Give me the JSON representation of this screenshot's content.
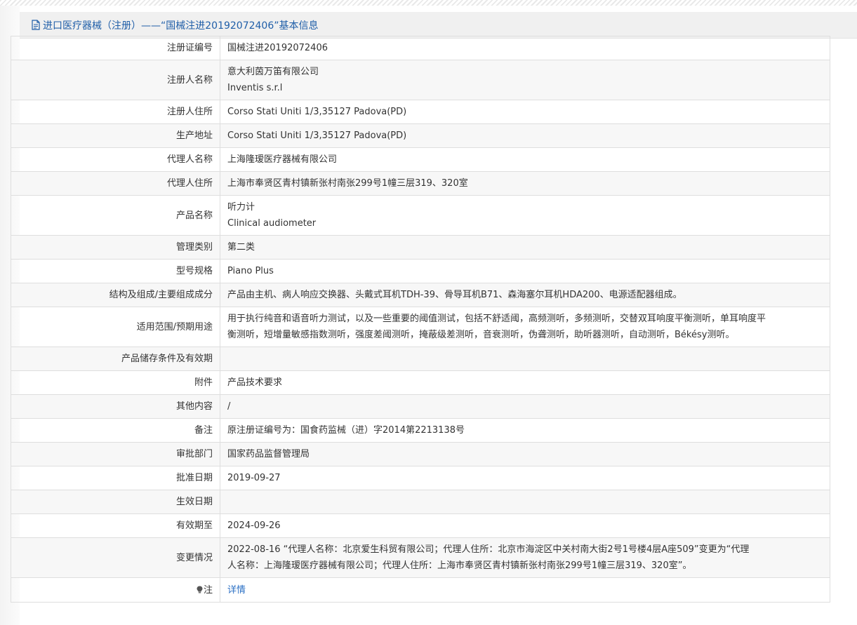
{
  "header": {
    "title": "进口医疗器械（注册）——“国械注进20192072406”基本信息"
  },
  "fields": {
    "reg_no": {
      "label": "注册证编号",
      "value": "国械注进20192072406"
    },
    "registrant": {
      "label": "注册人名称",
      "line1": "意大利茵万笛有限公司",
      "line2": "Inventis s.r.l"
    },
    "registrant_address": {
      "label": "注册人住所",
      "value": "Corso Stati Uniti 1/3,35127 Padova(PD)"
    },
    "production_address": {
      "label": "生产地址",
      "value": "Corso Stati Uniti 1/3,35127 Padova(PD)"
    },
    "agent_name": {
      "label": "代理人名称",
      "value": "上海隆瑷医疗器械有限公司"
    },
    "agent_address": {
      "label": "代理人住所",
      "value": "上海市奉贤区青村镇新张村南张299号1幢三层319、320室"
    },
    "product_name": {
      "label": "产品名称",
      "line1": "听力计",
      "line2": "Clinical audiometer"
    },
    "management_class": {
      "label": "管理类别",
      "value": "第二类"
    },
    "model": {
      "label": "型号规格",
      "value": "Piano Plus"
    },
    "structure": {
      "label": "结构及组成/主要组成成分",
      "value": "产品由主机、病人响应交换器、头戴式耳机TDH-39、骨导耳机B71、森海塞尔耳机HDA200、电源适配器组成。"
    },
    "intended_use": {
      "label": "适用范围/预期用途",
      "line1": "用于执行纯音和语音听力测试，以及一些重要的阈值测试，包括不舒适阈，高频测听，多频测听，交替双耳响度平衡测听，单耳响度平",
      "line2": "衡测听，短增量敏感指数测听，强度差阈测听，掩蔽级差测听，音衰测听，伪聋测听，助听器测听，自动测听，Békésy测听。"
    },
    "storage": {
      "label": "产品储存条件及有效期",
      "value": ""
    },
    "attachment": {
      "label": "附件",
      "value": "产品技术要求"
    },
    "other": {
      "label": "其他内容",
      "value": "/"
    },
    "remark": {
      "label": "备注",
      "value": "原注册证编号为：国食药监械（进）字2014第2213138号"
    },
    "approval_dept": {
      "label": "审批部门",
      "value": "国家药品监督管理局"
    },
    "approval_date": {
      "label": "批准日期",
      "value": "2019-09-27"
    },
    "effective_date": {
      "label": "生效日期",
      "value": ""
    },
    "valid_until": {
      "label": "有效期至",
      "value": "2024-09-26"
    },
    "changes": {
      "label": "变更情况",
      "line1": "2022-08-16 “代理人名称：北京爱生科贸有限公司；代理人住所：北京市海淀区中关村南大街2号1号楼4层A座509”变更为“代理",
      "line2": "人名称：上海隆瑷医疗器械有限公司；代理人住所：上海市奉贤区青村镇新张村南张299号1幢三层319、320室”。"
    },
    "note": {
      "label": "注",
      "link": "详情"
    }
  },
  "icons": {
    "header_icon": "document-icon",
    "note_icon": "bulb-icon"
  },
  "colors": {
    "title": "#1f5ea8",
    "link": "#2a6fc4"
  }
}
